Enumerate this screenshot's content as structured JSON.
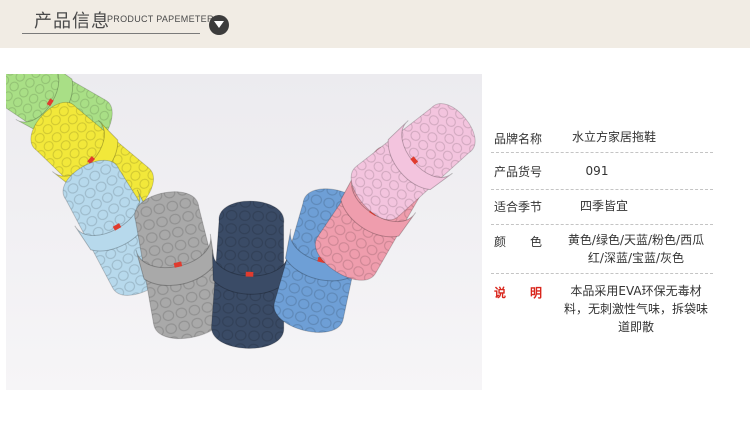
{
  "header": {
    "title_cn": "产品信息",
    "title_en": "PRODUCT PAPEMETERS",
    "dropdown_icon": "chevron-down-circle-icon"
  },
  "photo": {
    "description_icon": "slippers-product-photo",
    "colors": [
      "#a9df86",
      "#f2e83a",
      "#b7d9ec",
      "#a9a9a9",
      "#3a4b66",
      "#6e9fd6",
      "#ef9dad",
      "#f3c4de"
    ]
  },
  "specs": [
    {
      "label": "品牌名称",
      "value": "水立方家居拖鞋",
      "highlight": false
    },
    {
      "label": "产品货号",
      "value": "091",
      "highlight": false
    },
    {
      "label": "适合季节",
      "value": "四季皆宜",
      "highlight": false
    },
    {
      "label": "颜　　色",
      "value": "黄色/绿色/天蓝/粉色/西瓜红/深蓝/宝蓝/灰色",
      "highlight": false
    },
    {
      "label": "说　　明",
      "value": "本品采用EVA环保无毒材料，无刺激性气味，拆袋味道即散",
      "highlight": true
    }
  ],
  "accent_color": "#d9261c",
  "header_bg": "#f1ece4"
}
